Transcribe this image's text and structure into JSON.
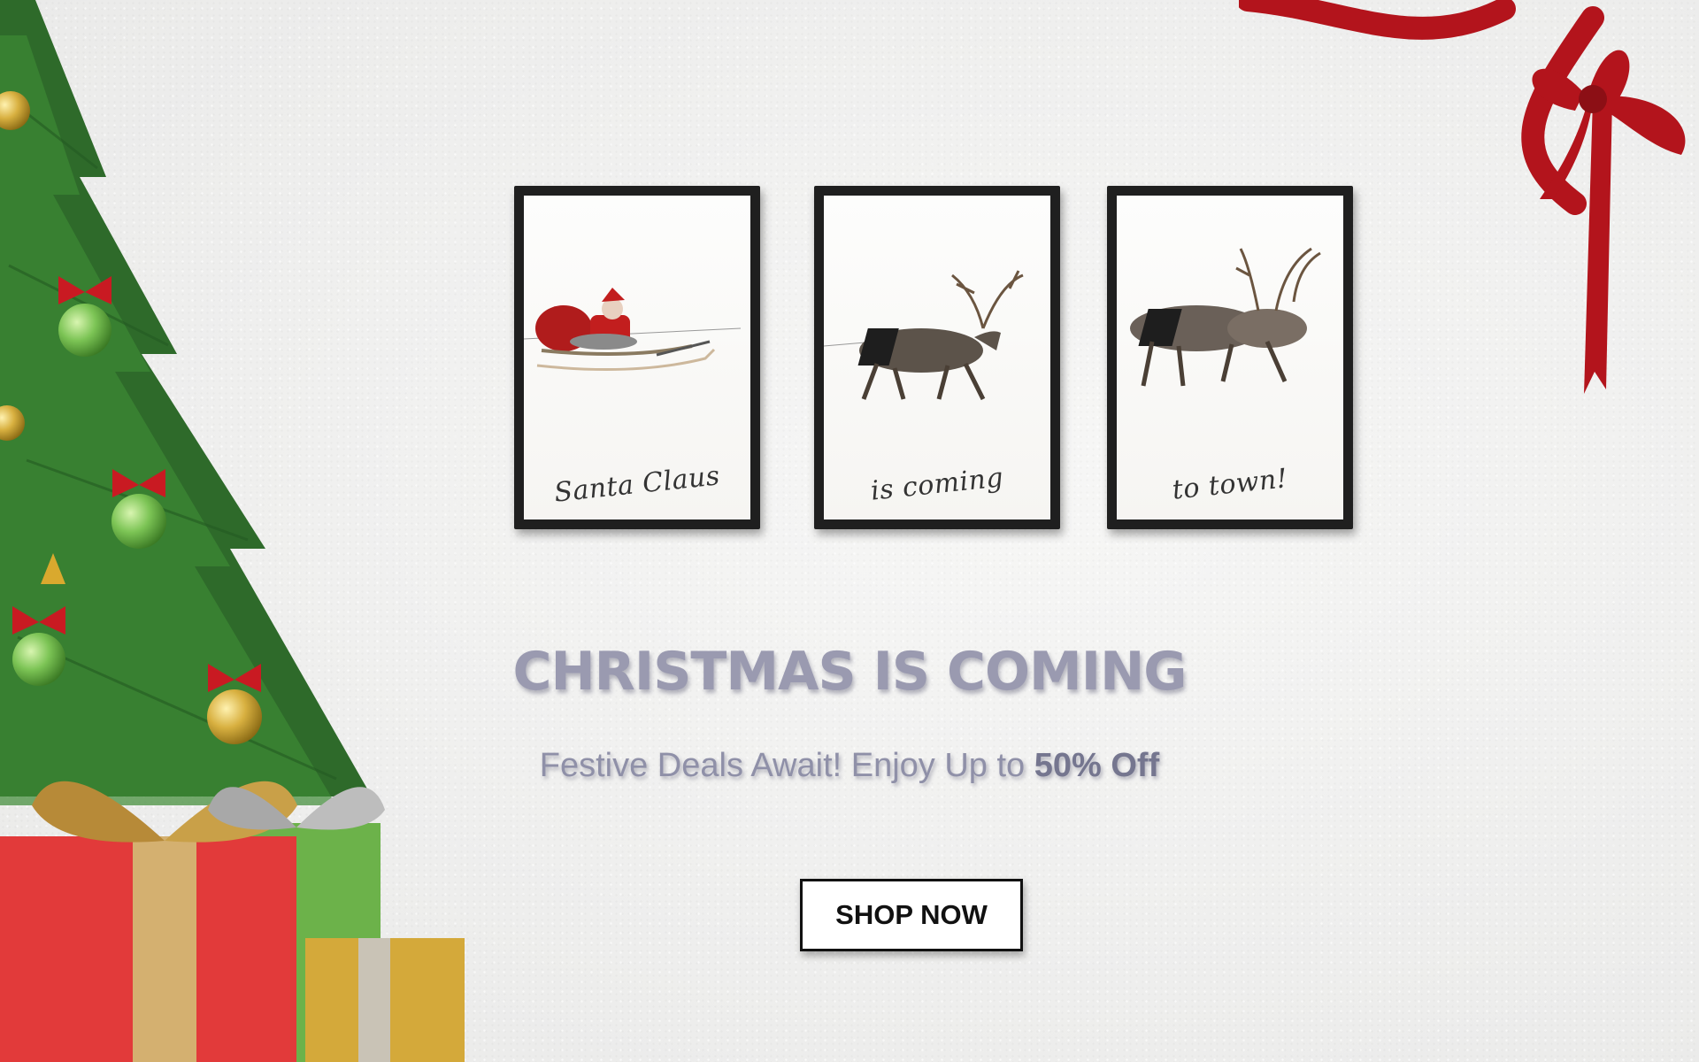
{
  "frames": [
    {
      "caption": "Santa Claus",
      "scene": "santa-sleigh"
    },
    {
      "caption": "is coming",
      "scene": "reindeer-team"
    },
    {
      "caption": "to town!",
      "scene": "reindeer-herd"
    }
  ],
  "headline": "CHRISTMAS IS COMING",
  "subline": {
    "text": "Festive Deals Await! Enjoy Up to ",
    "highlight": "50% Off"
  },
  "cta": {
    "label": "SHOP NOW"
  },
  "colors": {
    "ribbon": "#b3141c",
    "tree": "#2f6b2a",
    "gift_red": "#e23a3a",
    "gift_green": "#6cb24a",
    "gift_gold": "#d4a93a"
  }
}
